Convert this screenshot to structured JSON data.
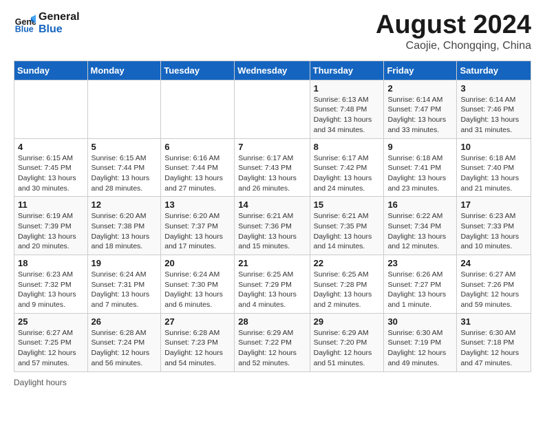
{
  "logo": {
    "line1": "General",
    "line2": "Blue"
  },
  "title": "August 2024",
  "subtitle": "Caojie, Chongqing, China",
  "days_of_week": [
    "Sunday",
    "Monday",
    "Tuesday",
    "Wednesday",
    "Thursday",
    "Friday",
    "Saturday"
  ],
  "weeks": [
    [
      {
        "num": "",
        "info": ""
      },
      {
        "num": "",
        "info": ""
      },
      {
        "num": "",
        "info": ""
      },
      {
        "num": "",
        "info": ""
      },
      {
        "num": "1",
        "info": "Sunrise: 6:13 AM\nSunset: 7:48 PM\nDaylight: 13 hours and 34 minutes."
      },
      {
        "num": "2",
        "info": "Sunrise: 6:14 AM\nSunset: 7:47 PM\nDaylight: 13 hours and 33 minutes."
      },
      {
        "num": "3",
        "info": "Sunrise: 6:14 AM\nSunset: 7:46 PM\nDaylight: 13 hours and 31 minutes."
      }
    ],
    [
      {
        "num": "4",
        "info": "Sunrise: 6:15 AM\nSunset: 7:45 PM\nDaylight: 13 hours and 30 minutes."
      },
      {
        "num": "5",
        "info": "Sunrise: 6:15 AM\nSunset: 7:44 PM\nDaylight: 13 hours and 28 minutes."
      },
      {
        "num": "6",
        "info": "Sunrise: 6:16 AM\nSunset: 7:44 PM\nDaylight: 13 hours and 27 minutes."
      },
      {
        "num": "7",
        "info": "Sunrise: 6:17 AM\nSunset: 7:43 PM\nDaylight: 13 hours and 26 minutes."
      },
      {
        "num": "8",
        "info": "Sunrise: 6:17 AM\nSunset: 7:42 PM\nDaylight: 13 hours and 24 minutes."
      },
      {
        "num": "9",
        "info": "Sunrise: 6:18 AM\nSunset: 7:41 PM\nDaylight: 13 hours and 23 minutes."
      },
      {
        "num": "10",
        "info": "Sunrise: 6:18 AM\nSunset: 7:40 PM\nDaylight: 13 hours and 21 minutes."
      }
    ],
    [
      {
        "num": "11",
        "info": "Sunrise: 6:19 AM\nSunset: 7:39 PM\nDaylight: 13 hours and 20 minutes."
      },
      {
        "num": "12",
        "info": "Sunrise: 6:20 AM\nSunset: 7:38 PM\nDaylight: 13 hours and 18 minutes."
      },
      {
        "num": "13",
        "info": "Sunrise: 6:20 AM\nSunset: 7:37 PM\nDaylight: 13 hours and 17 minutes."
      },
      {
        "num": "14",
        "info": "Sunrise: 6:21 AM\nSunset: 7:36 PM\nDaylight: 13 hours and 15 minutes."
      },
      {
        "num": "15",
        "info": "Sunrise: 6:21 AM\nSunset: 7:35 PM\nDaylight: 13 hours and 14 minutes."
      },
      {
        "num": "16",
        "info": "Sunrise: 6:22 AM\nSunset: 7:34 PM\nDaylight: 13 hours and 12 minutes."
      },
      {
        "num": "17",
        "info": "Sunrise: 6:23 AM\nSunset: 7:33 PM\nDaylight: 13 hours and 10 minutes."
      }
    ],
    [
      {
        "num": "18",
        "info": "Sunrise: 6:23 AM\nSunset: 7:32 PM\nDaylight: 13 hours and 9 minutes."
      },
      {
        "num": "19",
        "info": "Sunrise: 6:24 AM\nSunset: 7:31 PM\nDaylight: 13 hours and 7 minutes."
      },
      {
        "num": "20",
        "info": "Sunrise: 6:24 AM\nSunset: 7:30 PM\nDaylight: 13 hours and 6 minutes."
      },
      {
        "num": "21",
        "info": "Sunrise: 6:25 AM\nSunset: 7:29 PM\nDaylight: 13 hours and 4 minutes."
      },
      {
        "num": "22",
        "info": "Sunrise: 6:25 AM\nSunset: 7:28 PM\nDaylight: 13 hours and 2 minutes."
      },
      {
        "num": "23",
        "info": "Sunrise: 6:26 AM\nSunset: 7:27 PM\nDaylight: 13 hours and 1 minute."
      },
      {
        "num": "24",
        "info": "Sunrise: 6:27 AM\nSunset: 7:26 PM\nDaylight: 12 hours and 59 minutes."
      }
    ],
    [
      {
        "num": "25",
        "info": "Sunrise: 6:27 AM\nSunset: 7:25 PM\nDaylight: 12 hours and 57 minutes."
      },
      {
        "num": "26",
        "info": "Sunrise: 6:28 AM\nSunset: 7:24 PM\nDaylight: 12 hours and 56 minutes."
      },
      {
        "num": "27",
        "info": "Sunrise: 6:28 AM\nSunset: 7:23 PM\nDaylight: 12 hours and 54 minutes."
      },
      {
        "num": "28",
        "info": "Sunrise: 6:29 AM\nSunset: 7:22 PM\nDaylight: 12 hours and 52 minutes."
      },
      {
        "num": "29",
        "info": "Sunrise: 6:29 AM\nSunset: 7:20 PM\nDaylight: 12 hours and 51 minutes."
      },
      {
        "num": "30",
        "info": "Sunrise: 6:30 AM\nSunset: 7:19 PM\nDaylight: 12 hours and 49 minutes."
      },
      {
        "num": "31",
        "info": "Sunrise: 6:30 AM\nSunset: 7:18 PM\nDaylight: 12 hours and 47 minutes."
      }
    ]
  ],
  "footer": "Daylight hours"
}
